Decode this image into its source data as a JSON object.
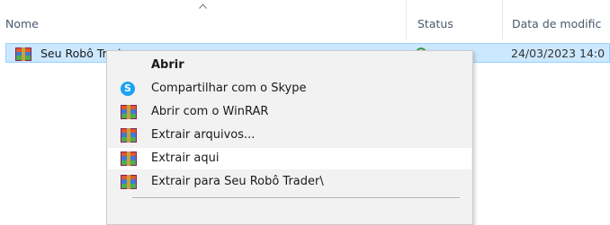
{
  "header": {
    "columns": [
      {
        "label": "Nome"
      },
      {
        "label": "Status"
      },
      {
        "label": "Data de modific"
      }
    ]
  },
  "file": {
    "name": "Seu Robô Trader",
    "date": "24/03/2023 14:0",
    "icon": "winrar-archive-icon"
  },
  "context_menu": {
    "items": [
      {
        "label": "Abrir",
        "icon": "none",
        "bold": true
      },
      {
        "label": "Compartilhar com o Skype",
        "icon": "skype-icon"
      },
      {
        "label": "Abrir com o WinRAR",
        "icon": "winrar-icon"
      },
      {
        "label": "Extrair arquivos...",
        "icon": "winrar-icon"
      },
      {
        "label": "Extrair aqui",
        "icon": "winrar-icon",
        "hovered": true
      },
      {
        "label": "Extrair para Seu Robô Trader\\",
        "icon": "winrar-icon"
      }
    ]
  },
  "colors": {
    "selection": "#cce8ff",
    "selection_border": "#99d1ff",
    "menu_bg": "#f2f2f2",
    "hover": "#ffffff"
  }
}
